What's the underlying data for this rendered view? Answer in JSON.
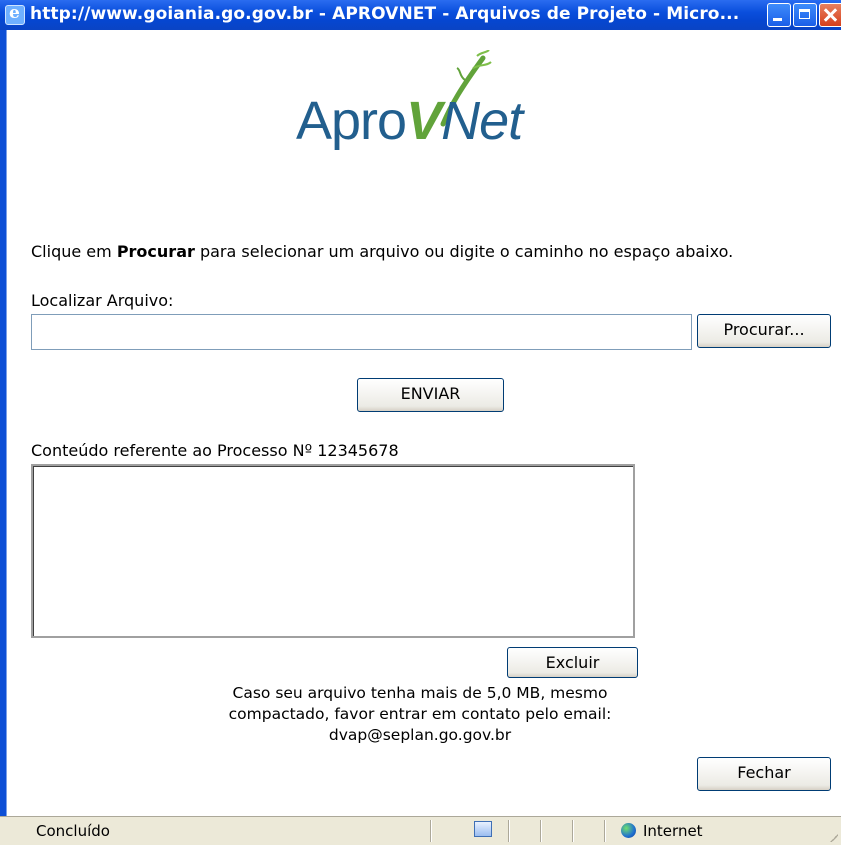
{
  "window": {
    "title": "http://www.goiania.go.gov.br - APROVNET - Arquivos de Projeto - Micro...",
    "minimize_icon": "minimize-icon",
    "maximize_icon": "maximize-icon",
    "close_icon": "close-icon",
    "ie_icon": "internet-explorer-icon"
  },
  "logo": {
    "part1": "Apro",
    "part2": "V",
    "part3": "Net",
    "accent_color": "#61a33a",
    "brand_color": "#225f8e"
  },
  "instructions": {
    "prefix": "Clique em ",
    "bold": "Procurar",
    "suffix": " para selecionar um arquivo ou digite o caminho no espaço abaixo."
  },
  "file": {
    "label": "Localizar Arquivo:",
    "value": "",
    "browse_label": "Procurar..."
  },
  "send_label": "ENVIAR",
  "content": {
    "label": "Conteúdo referente ao Processo Nº ",
    "process_number": "12345678",
    "items": []
  },
  "delete_label": "Excluir",
  "note": {
    "line1": "Caso seu arquivo tenha mais de 5,0 MB, mesmo",
    "line2": "compactado, favor entrar em contato pelo email:",
    "line3": "dvap@seplan.go.gov.br"
  },
  "close_label": "Fechar",
  "statusbar": {
    "status": "Concluído",
    "zone": "Internet",
    "zone_icon": "globe-icon",
    "page_icon": "page-icon"
  }
}
